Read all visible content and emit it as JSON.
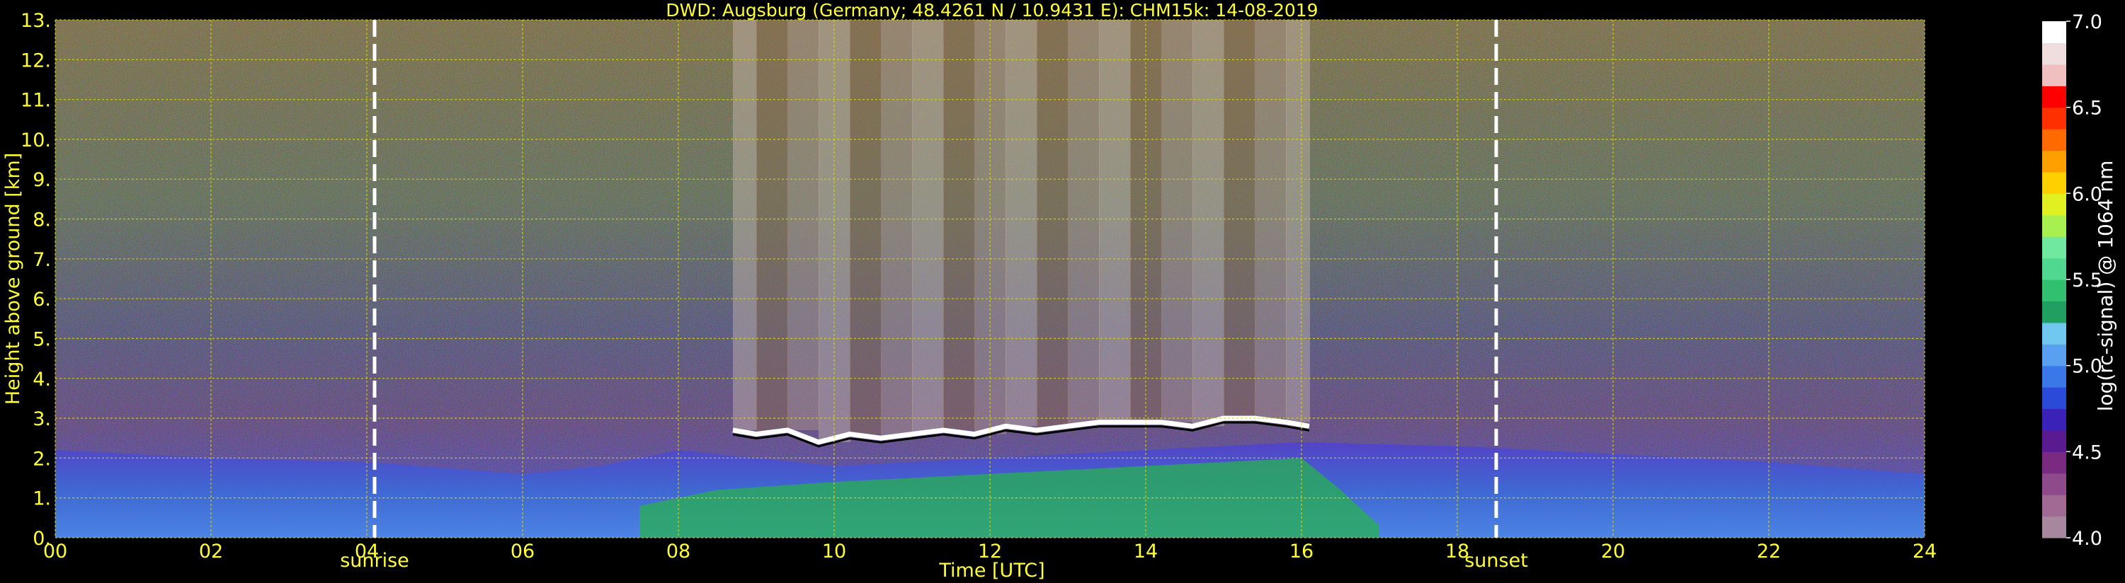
{
  "chart_data": {
    "type": "heatmap",
    "title": "DWD: Augsburg (Germany; 48.4261 N / 10.9431 E):    CHM15k: 14-08-2019",
    "xlabel": "Time [UTC]",
    "ylabel": "Height above ground [km]",
    "x_range": [
      0,
      24
    ],
    "y_range": [
      0,
      13
    ],
    "x_ticks": [
      0,
      2,
      4,
      6,
      8,
      10,
      12,
      14,
      16,
      18,
      20,
      22,
      24
    ],
    "x_tick_labels": [
      "00",
      "02",
      "04",
      "06",
      "08",
      "10",
      "12",
      "14",
      "16",
      "18",
      "20",
      "22",
      "24"
    ],
    "y_ticks": [
      0,
      1,
      2,
      3,
      4,
      5,
      6,
      7,
      8,
      9,
      10,
      11,
      12,
      13
    ],
    "y_tick_labels": [
      "0.",
      "1.",
      "2.",
      "3.",
      "4.",
      "5.",
      "6.",
      "7.",
      "8.",
      "9.",
      "10.",
      "11.",
      "12.",
      "13."
    ],
    "grid": true,
    "markers": [
      {
        "name": "sunrise",
        "time": 4.1
      },
      {
        "name": "sunset",
        "time": 18.5
      }
    ],
    "cloud_base_km": [
      [
        8.7,
        2.7
      ],
      [
        9.0,
        2.6
      ],
      [
        9.4,
        2.7
      ],
      [
        9.8,
        2.4
      ],
      [
        10.2,
        2.6
      ],
      [
        10.6,
        2.5
      ],
      [
        11.0,
        2.6
      ],
      [
        11.4,
        2.7
      ],
      [
        11.8,
        2.6
      ],
      [
        12.2,
        2.8
      ],
      [
        12.6,
        2.7
      ],
      [
        13.0,
        2.8
      ],
      [
        13.4,
        2.9
      ],
      [
        13.8,
        2.9
      ],
      [
        14.2,
        2.9
      ],
      [
        14.6,
        2.8
      ],
      [
        15.0,
        3.0
      ],
      [
        15.4,
        3.0
      ],
      [
        15.8,
        2.9
      ],
      [
        16.1,
        2.8
      ]
    ],
    "boundary_layer_top_km": [
      [
        0.0,
        2.2
      ],
      [
        2.0,
        2.0
      ],
      [
        4.0,
        1.9
      ],
      [
        6.0,
        1.6
      ],
      [
        7.0,
        1.8
      ],
      [
        8.0,
        2.2
      ],
      [
        10.0,
        1.8
      ],
      [
        12.0,
        2.0
      ],
      [
        14.0,
        2.2
      ],
      [
        16.0,
        2.4
      ],
      [
        18.0,
        2.3
      ],
      [
        20.0,
        2.1
      ],
      [
        22.0,
        1.9
      ],
      [
        24.0,
        1.6
      ]
    ],
    "colorbar": {
      "label": "log(rc-signal) @ 1064 nm",
      "range": [
        4.0,
        7.0
      ],
      "ticks": [
        4.0,
        4.5,
        5.0,
        5.5,
        6.0,
        6.5,
        7.0
      ],
      "tick_labels": [
        "4.0",
        "4.5",
        "5.0",
        "5.5",
        "6.0",
        "6.5",
        "7.0"
      ],
      "colors": [
        "#a7879e",
        "#a16a95",
        "#8f4a8c",
        "#7a2a80",
        "#5a1a90",
        "#3a22b8",
        "#2a4ad8",
        "#3a78ea",
        "#5aa0f0",
        "#70c8f0",
        "#20a060",
        "#30c070",
        "#50d890",
        "#70e8a0",
        "#a8f050",
        "#e0f020",
        "#ffd000",
        "#ffa000",
        "#ff6a00",
        "#ff3000",
        "#ff0000",
        "#f0c0c0",
        "#f0dede",
        "#ffffff"
      ]
    }
  }
}
